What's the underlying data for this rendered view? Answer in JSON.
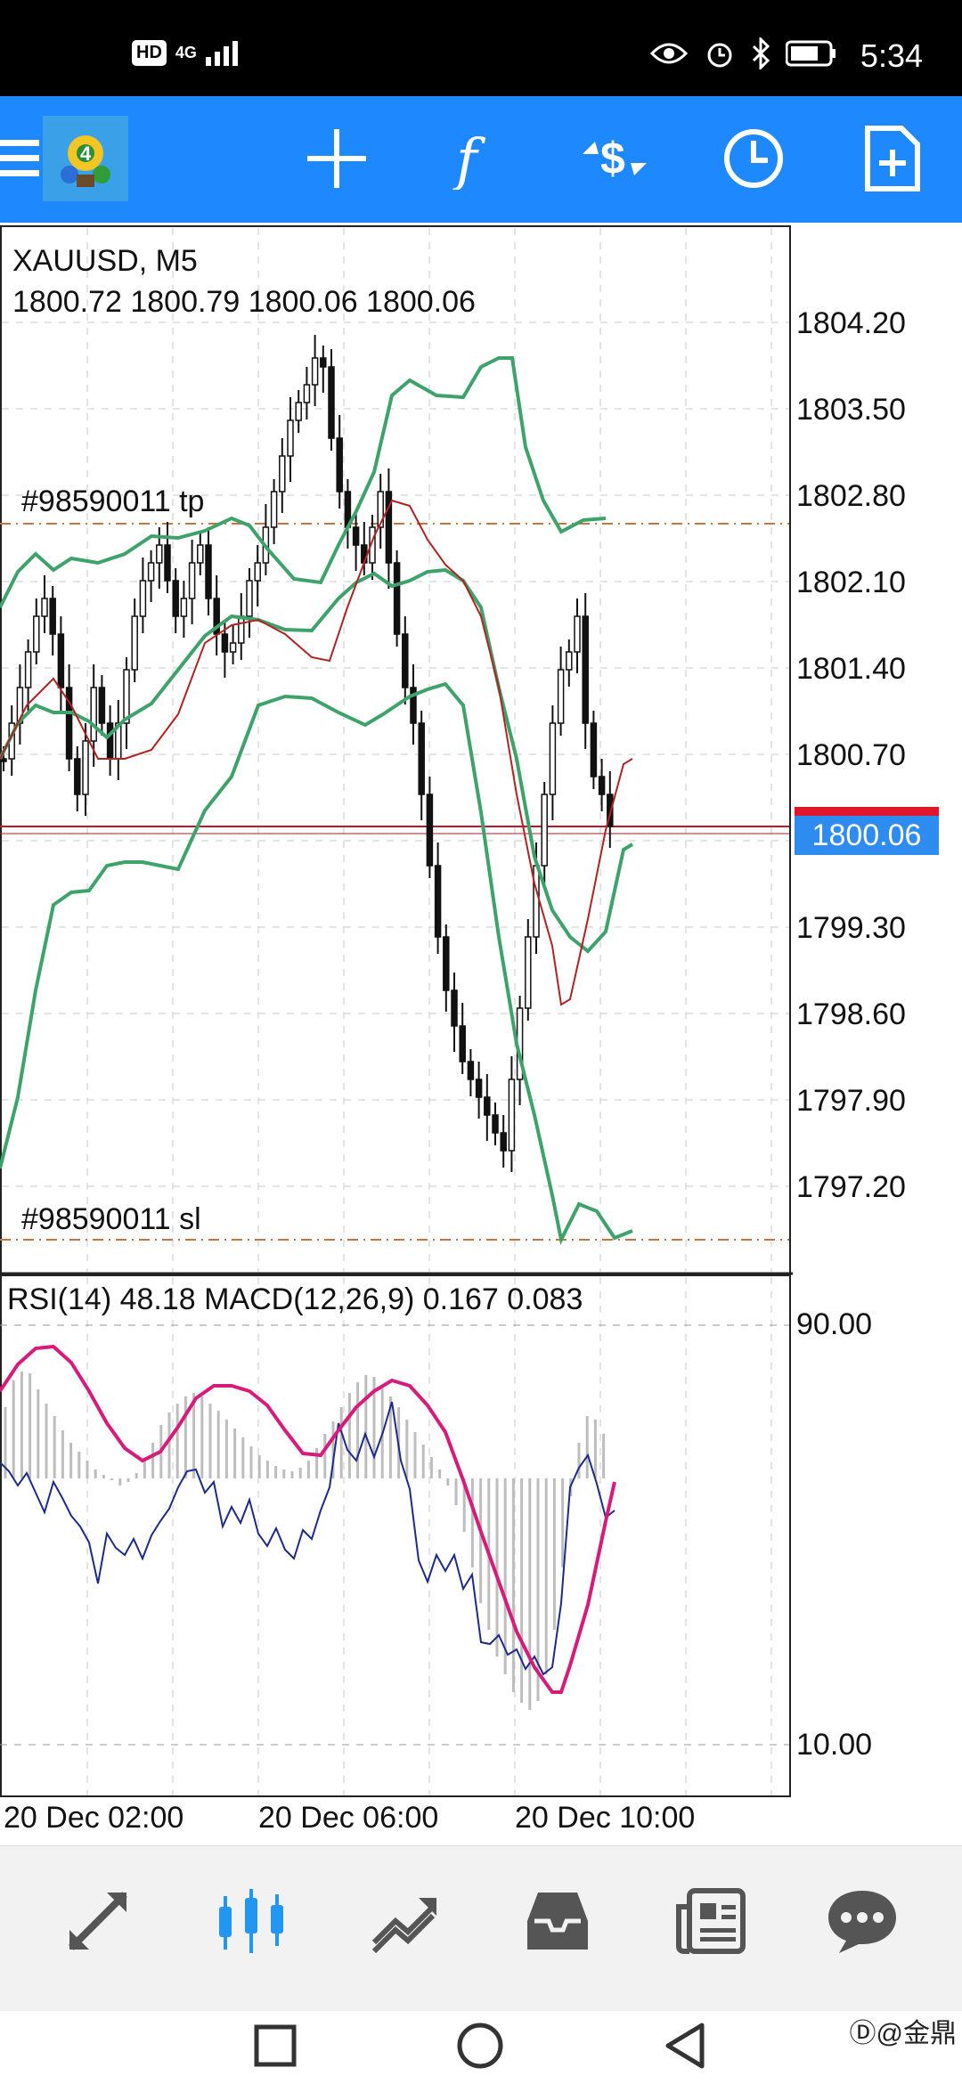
{
  "status_bar": {
    "hd": "HD",
    "network": "4G",
    "time": "5:34"
  },
  "toolbar": {
    "icons": [
      "menu-icon",
      "mt4-logo-icon",
      "crosshair-icon",
      "indicators-icon",
      "trade-icon",
      "timeframe-icon",
      "new-order-icon"
    ]
  },
  "chart": {
    "symbol": "XAUUSD, M5",
    "ohlc": "1800.72 1800.79 1800.06 1800.06",
    "tp_label": "#98590011 tp",
    "sl_label": "#98590011 sl",
    "current_price": "1800.06",
    "price_axis": [
      "1804.20",
      "1803.50",
      "1802.80",
      "1802.10",
      "1801.40",
      "1800.70",
      "1799.30",
      "1798.60",
      "1797.90",
      "1797.20"
    ],
    "indicator_title": "RSI(14) 48.18 MACD(12,26,9) 0.167 0.083",
    "indicator_axis": [
      "90.00",
      "10.00"
    ],
    "time_axis": [
      "20 Dec 02:00",
      "20 Dec 06:00",
      "20 Dec 10:00"
    ]
  },
  "bottom_nav": {
    "items": [
      "quotes-icon",
      "chart-icon",
      "trade-icon",
      "history-icon",
      "news-icon",
      "chat-icon"
    ]
  },
  "system_nav": {
    "items": [
      "recents-button",
      "home-button",
      "back-button"
    ]
  },
  "watermark": "Ⓓ@金鼎"
}
